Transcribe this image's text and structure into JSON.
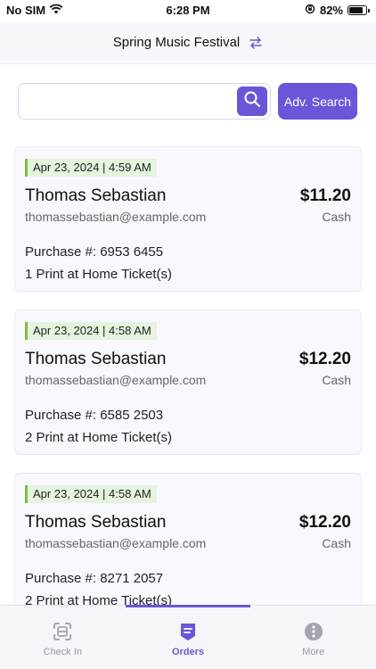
{
  "status": {
    "carrier": "No SIM",
    "time": "6:28 PM",
    "battery": "82%",
    "battery_level": 0.82
  },
  "header": {
    "title": "Spring Music Festival",
    "swap_icon": "swap-arrows-icon"
  },
  "search": {
    "placeholder": "",
    "value": "",
    "adv_label": "Adv. Search"
  },
  "orders": [
    {
      "date": "Apr 23, 2024 | 4:59 AM",
      "name": "Thomas Sebastian",
      "email": "thomassebastian@example.com",
      "amount": "$11.20",
      "payment": "Cash",
      "purchase": "Purchase #: 6953 6455",
      "tickets": "1 Print at Home Ticket(s)"
    },
    {
      "date": "Apr 23, 2024 | 4:58 AM",
      "name": "Thomas Sebastian",
      "email": "thomassebastian@example.com",
      "amount": "$12.20",
      "payment": "Cash",
      "purchase": "Purchase #: 6585 2503",
      "tickets": "2 Print at Home Ticket(s)"
    },
    {
      "date": "Apr 23, 2024 | 4:58 AM",
      "name": "Thomas Sebastian",
      "email": "thomassebastian@example.com",
      "amount": "$12.20",
      "payment": "Cash",
      "purchase": "Purchase #: 8271 2057",
      "tickets": "2 Print at Home Ticket(s)"
    }
  ],
  "tabs": [
    {
      "label": "Check In",
      "icon": "scan-icon",
      "active": false
    },
    {
      "label": "Orders",
      "icon": "orders-icon",
      "active": true
    },
    {
      "label": "More",
      "icon": "more-icon",
      "active": false
    }
  ],
  "colors": {
    "accent": "#6a56d8",
    "date_badge_bg": "#e6f3dd",
    "date_badge_border": "#7bbf44"
  }
}
